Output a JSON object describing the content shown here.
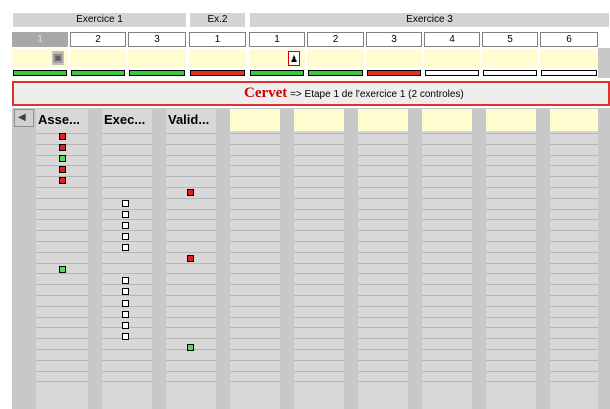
{
  "top_header": {
    "groups": [
      {
        "label": "Exercice 1"
      },
      {
        "label": "Ex.2"
      },
      {
        "label": "Exercice 3"
      }
    ],
    "numbers": [
      "1",
      "2",
      "3",
      "1",
      "1",
      "2",
      "3",
      "4",
      "5",
      "6"
    ],
    "progress_colors": [
      "green",
      "green",
      "green",
      "red",
      "green",
      "green",
      "red",
      "empty",
      "empty",
      "empty"
    ]
  },
  "colors": {
    "green": "#3cc83c",
    "red": "#e03020",
    "empty": "#ffffff",
    "cream": "#fffdd0",
    "message_border": "#e03030",
    "student_name": "#d00000"
  },
  "message": {
    "name": "Cervet",
    "text": " => Etape 1 de l'exercice 1 (2 controles)"
  },
  "icons": {
    "lock": "lock-icon",
    "person": "person-icon",
    "scroll_left": "scroll-left-icon"
  },
  "grid": {
    "columns": [
      {
        "label": "Asse..."
      },
      {
        "label": "Exec..."
      },
      {
        "label": "Valid..."
      },
      {
        "label": ""
      },
      {
        "label": ""
      },
      {
        "label": ""
      },
      {
        "label": ""
      },
      {
        "label": ""
      },
      {
        "label": ""
      }
    ],
    "marks": [
      {
        "col": 0,
        "row": 0,
        "color": "red"
      },
      {
        "col": 0,
        "row": 1,
        "color": "red"
      },
      {
        "col": 0,
        "row": 2,
        "color": "green"
      },
      {
        "col": 0,
        "row": 3,
        "color": "red"
      },
      {
        "col": 0,
        "row": 4,
        "color": "red"
      },
      {
        "col": 2,
        "row": 5,
        "color": "red"
      },
      {
        "col": 1,
        "row": 6,
        "color": "white"
      },
      {
        "col": 1,
        "row": 7,
        "color": "white"
      },
      {
        "col": 1,
        "row": 8,
        "color": "white"
      },
      {
        "col": 1,
        "row": 9,
        "color": "white"
      },
      {
        "col": 1,
        "row": 10,
        "color": "white"
      },
      {
        "col": 2,
        "row": 11,
        "color": "red"
      },
      {
        "col": 0,
        "row": 12,
        "color": "green"
      },
      {
        "col": 1,
        "row": 13,
        "color": "white"
      },
      {
        "col": 1,
        "row": 14,
        "color": "white"
      },
      {
        "col": 1,
        "row": 15,
        "color": "white"
      },
      {
        "col": 1,
        "row": 16,
        "color": "white"
      },
      {
        "col": 1,
        "row": 17,
        "color": "white"
      },
      {
        "col": 1,
        "row": 18,
        "color": "white"
      },
      {
        "col": 2,
        "row": 19,
        "color": "green"
      }
    ],
    "row_count": 24
  }
}
